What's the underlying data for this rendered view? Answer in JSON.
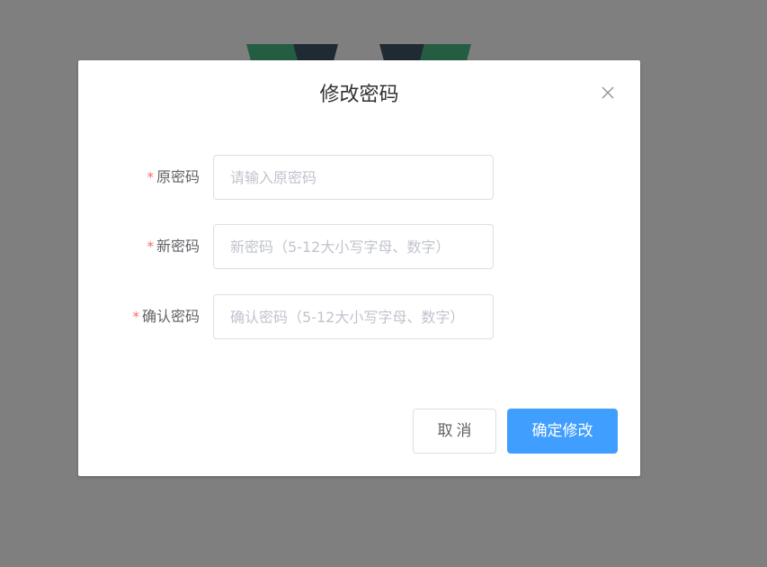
{
  "dialog": {
    "title": "修改密码",
    "close_icon": "close-icon"
  },
  "form": {
    "required_mark": "*",
    "old_password": {
      "label": "原密码",
      "placeholder": "请输入原密码",
      "value": ""
    },
    "new_password": {
      "label": "新密码",
      "placeholder": "新密码（5-12大小写字母、数字）",
      "value": ""
    },
    "confirm_password": {
      "label": "确认密码",
      "placeholder": "确认密码（5-12大小写字母、数字）",
      "value": ""
    }
  },
  "footer": {
    "cancel_label": "取消",
    "confirm_label": "确定修改"
  },
  "colors": {
    "overlay": "#7f7f7f",
    "primary": "#409eff",
    "required": "#f56c6c",
    "label": "#606266",
    "placeholder": "#c0c4cc",
    "border": "#dcdfe6"
  }
}
